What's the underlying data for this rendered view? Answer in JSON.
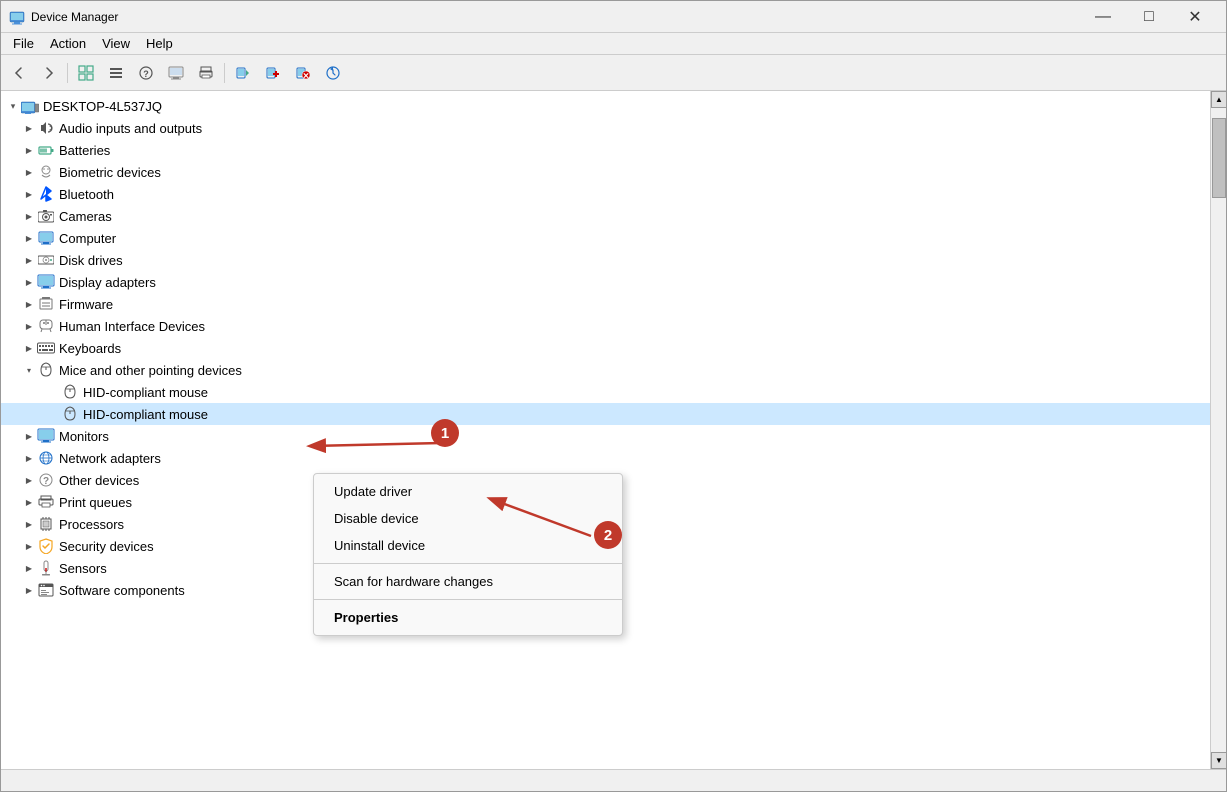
{
  "window": {
    "title": "Device Manager",
    "icon": "🖥"
  },
  "titlebar": {
    "minimize": "—",
    "maximize": "□",
    "close": "✕"
  },
  "menubar": {
    "items": [
      "File",
      "Action",
      "View",
      "Help"
    ]
  },
  "toolbar": {
    "buttons": [
      "◀",
      "▶",
      "⊞",
      "≡",
      "?",
      "⊟",
      "🖨",
      "💻",
      "🔖",
      "✕",
      "⊙"
    ]
  },
  "tree": {
    "root": "DESKTOP-4L537JQ",
    "items": [
      {
        "label": "Audio inputs and outputs",
        "icon": "🔊",
        "indent": 1,
        "expanded": false
      },
      {
        "label": "Batteries",
        "icon": "🔋",
        "indent": 1,
        "expanded": false
      },
      {
        "label": "Biometric devices",
        "icon": "👤",
        "indent": 1,
        "expanded": false
      },
      {
        "label": "Bluetooth",
        "icon": "⬡",
        "indent": 1,
        "expanded": false
      },
      {
        "label": "Cameras",
        "icon": "📷",
        "indent": 1,
        "expanded": false
      },
      {
        "label": "Computer",
        "icon": "💻",
        "indent": 1,
        "expanded": false
      },
      {
        "label": "Disk drives",
        "icon": "💾",
        "indent": 1,
        "expanded": false
      },
      {
        "label": "Display adapters",
        "icon": "🖥",
        "indent": 1,
        "expanded": false
      },
      {
        "label": "Firmware",
        "icon": "⚙",
        "indent": 1,
        "expanded": false
      },
      {
        "label": "Human Interface Devices",
        "icon": "🎮",
        "indent": 1,
        "expanded": false
      },
      {
        "label": "Keyboards",
        "icon": "⌨",
        "indent": 1,
        "expanded": false
      },
      {
        "label": "Mice and other pointing devices",
        "icon": "🖱",
        "indent": 1,
        "expanded": true
      },
      {
        "label": "HID-compliant mouse",
        "icon": "🖱",
        "indent": 2,
        "expanded": false
      },
      {
        "label": "HID-compliant mouse",
        "icon": "🖱",
        "indent": 2,
        "expanded": false,
        "selected": true
      },
      {
        "label": "Monitors",
        "icon": "🖥",
        "indent": 1,
        "expanded": false
      },
      {
        "label": "Network adapters",
        "icon": "🌐",
        "indent": 1,
        "expanded": false
      },
      {
        "label": "Other devices",
        "icon": "❓",
        "indent": 1,
        "expanded": false
      },
      {
        "label": "Print queues",
        "icon": "🖨",
        "indent": 1,
        "expanded": false
      },
      {
        "label": "Processors",
        "icon": "⚙",
        "indent": 1,
        "expanded": false
      },
      {
        "label": "Security devices",
        "icon": "🔐",
        "indent": 1,
        "expanded": false
      },
      {
        "label": "Sensors",
        "icon": "📡",
        "indent": 1,
        "expanded": false
      },
      {
        "label": "Software components",
        "icon": "📦",
        "indent": 1,
        "expanded": false
      }
    ]
  },
  "contextmenu": {
    "items": [
      {
        "label": "Update driver",
        "bold": false,
        "sep_after": false
      },
      {
        "label": "Disable device",
        "bold": false,
        "sep_after": false
      },
      {
        "label": "Uninstall device",
        "bold": false,
        "sep_after": true
      },
      {
        "label": "Scan for hardware changes",
        "bold": false,
        "sep_after": true
      },
      {
        "label": "Properties",
        "bold": true,
        "sep_after": false
      }
    ]
  },
  "annotations": {
    "badge1_label": "1",
    "badge2_label": "2"
  }
}
